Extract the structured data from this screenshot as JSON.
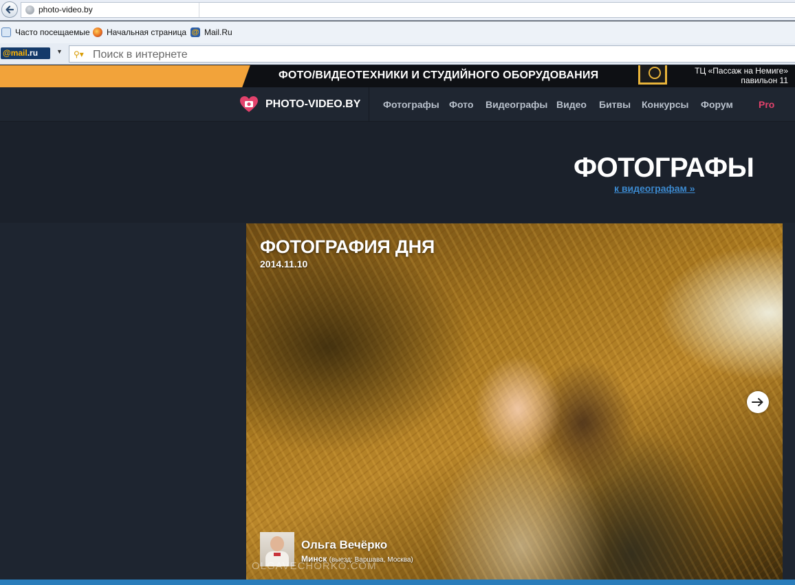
{
  "browser": {
    "url": "photo-video.by",
    "bookmarks": [
      {
        "label": "Часто посещаемые",
        "icon": "bookmark-page-icon"
      },
      {
        "label": "Начальная страница",
        "icon": "firefox-icon"
      },
      {
        "label": "Mail.Ru",
        "icon": "mailru-at-icon"
      }
    ],
    "mailru_logo": "@mail",
    "mailru_logo_ru": ".ru",
    "search_placeholder": "Поиск в интернете"
  },
  "banner": {
    "headline": "ФОТО/ВИДЕОТЕХНИКИ И СТУДИЙНОГО ОБОРУДОВАНИЯ",
    "address_line1": "ТЦ «Пассаж на Немиге»",
    "address_line2": "павильон 11",
    "accent_color": "#f2a33a"
  },
  "site": {
    "logo_text": "PHOTO-VIDEO.BY",
    "brand_color": "#e2426c",
    "nav": [
      {
        "label": "Фотографы"
      },
      {
        "label": "Фото"
      },
      {
        "label": "Видеографы"
      },
      {
        "label": "Видео"
      },
      {
        "label": "Битвы"
      },
      {
        "label": "Конкурсы"
      },
      {
        "label": "Форум"
      }
    ],
    "nav_pro": "Pro"
  },
  "hero": {
    "title": "ФОТОГРАФЫ",
    "link": "к видеографам »"
  },
  "photo_of_day": {
    "title": "ФОТОГРАФИЯ ДНЯ",
    "date": "2014.11.10",
    "author_name": "Ольга Вечёрко",
    "author_city": "Минск",
    "author_travel": "(выезд: Варшава, Москва)",
    "watermark": "OLGAVECHORKO.COM"
  }
}
